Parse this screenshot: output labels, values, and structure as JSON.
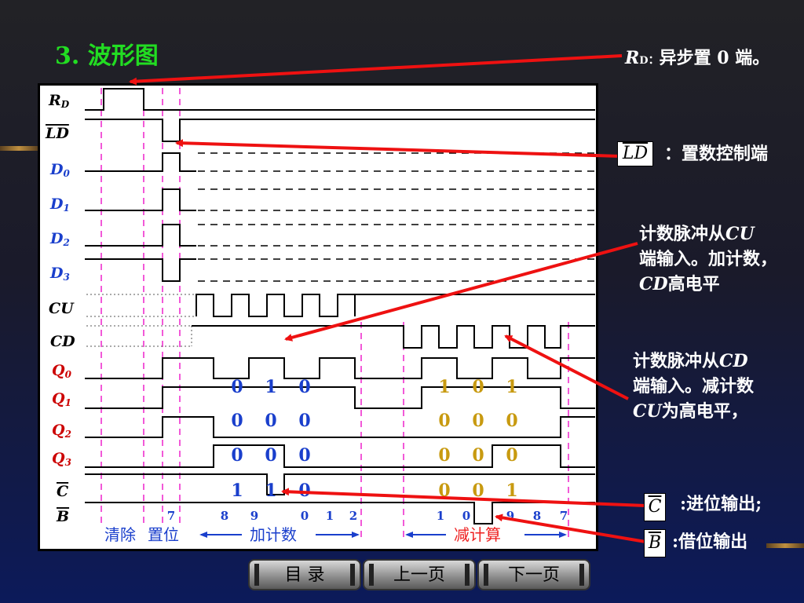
{
  "title": "3. 波形图",
  "signals": {
    "rd": {
      "main": "R",
      "sub": "D"
    },
    "ld": "LD",
    "d0": {
      "main": "D",
      "sub": "0"
    },
    "d1": {
      "main": "D",
      "sub": "1"
    },
    "d2": {
      "main": "D",
      "sub": "2"
    },
    "d3": {
      "main": "D",
      "sub": "3"
    },
    "cu": "CU",
    "cd": "CD",
    "q0": {
      "main": "Q",
      "sub": "0"
    },
    "q1": {
      "main": "Q",
      "sub": "1"
    },
    "q2": {
      "main": "Q",
      "sub": "2"
    },
    "q3": {
      "main": "Q",
      "sub": "3"
    },
    "c": "C",
    "b": "B"
  },
  "up_values": {
    "q0": [
      "0",
      "1",
      "0"
    ],
    "q1": [
      "0",
      "0",
      "0"
    ],
    "q2": [
      "0",
      "0",
      "0"
    ],
    "c": [
      "1",
      "1",
      "0"
    ]
  },
  "down_values": {
    "q0": [
      "1",
      "0",
      "1"
    ],
    "q1": [
      "0",
      "0",
      "0"
    ],
    "q2": [
      "0",
      "0",
      "0"
    ],
    "c": [
      "0",
      "0",
      "1"
    ]
  },
  "count_numbers": [
    "7",
    "8",
    "9",
    "0",
    "1",
    "2",
    "1",
    "0",
    "9",
    "8",
    "7"
  ],
  "phase_labels": {
    "clear": "清除",
    "preset": "置位",
    "up": "加计数",
    "down": "减计算"
  },
  "annotations": {
    "rd_main": "R",
    "rd_sub": "D",
    "rd_sep": "：",
    "rd_desc": "异步置 0 端。",
    "ld_label": "LD",
    "ld_desc": "：置数控制端",
    "up_line1_a": "计数脉冲从",
    "up_line1_b": "CU",
    "up_line2": "端输入。加计数，",
    "up_line3_a": "CD",
    "up_line3_b": "高电平",
    "down_line1_a": "计数脉冲从",
    "down_line1_b": "CD",
    "down_line2": "端输入。减计数",
    "down_line3_a": "CU",
    "down_line3_b": "为高电平，",
    "c_label": "C",
    "c_desc": ":进位输出;",
    "b_label": "B",
    "b_desc": ":借位输出"
  },
  "nav": {
    "toc": "目  录",
    "prev": "上一页",
    "next": "下一页"
  },
  "colors": {
    "title": "#22dd22",
    "label_black": "#000000",
    "label_blue": "#1a3fcc",
    "label_red": "#cc0000",
    "value_blue": "#1a3fcc",
    "value_gold": "#c89a10",
    "arrow_red": "#ee1111",
    "guide_magenta": "#ee22cc"
  }
}
